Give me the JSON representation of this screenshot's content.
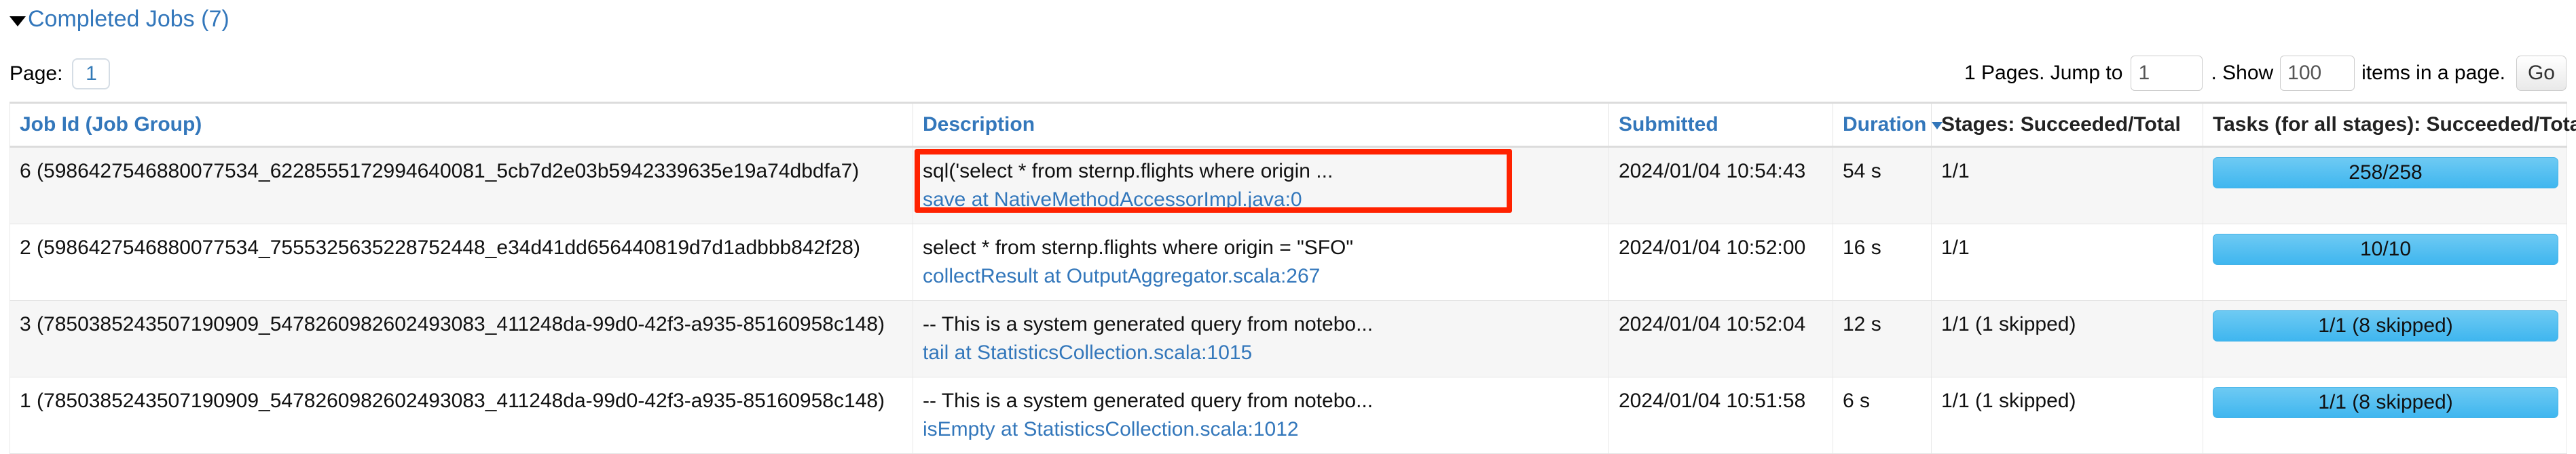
{
  "section": {
    "caret_icon": "caret-down-icon",
    "title": "Completed Jobs (7)"
  },
  "pagination": {
    "page_label": "Page:",
    "current_page": "1",
    "total_pages_text": "1 Pages. Jump to",
    "jump_value": "1",
    "show_text": ". Show",
    "show_value": "100",
    "items_text": "items in a page.",
    "go_label": "Go"
  },
  "table": {
    "headers": {
      "job_id": "Job Id (Job Group)",
      "description": "Description",
      "submitted": "Submitted",
      "duration": "Duration",
      "duration_sort_icon": "caret-down-icon",
      "stages": "Stages: Succeeded/Total",
      "tasks": "Tasks (for all stages): Succeeded/Total"
    },
    "rows": [
      {
        "job_id": "6 (5986427546880077534_6228555172994640081_5cb7d2e03b5942339635e19a74dbdfa7)",
        "desc_main": "sql('select * from sternp.flights where origin ...",
        "desc_link": "save at NativeMethodAccessorImpl.java:0",
        "submitted": "2024/01/04 10:54:43",
        "duration": "54 s",
        "stages": "1/1",
        "tasks": "258/258",
        "highlighted": true
      },
      {
        "job_id": "2 (5986427546880077534_7555325635228752448_e34d41dd656440819d7d1adbbb842f28)",
        "desc_main": "select * from sternp.flights where origin = \"SFO\"",
        "desc_link": "collectResult at OutputAggregator.scala:267",
        "submitted": "2024/01/04 10:52:00",
        "duration": "16 s",
        "stages": "1/1",
        "tasks": "10/10",
        "highlighted": false
      },
      {
        "job_id": "3 (7850385243507190909_5478260982602493083_411248da-99d0-42f3-a935-85160958c148)",
        "desc_main": "-- This is a system generated query from notebo...",
        "desc_link": "tail at StatisticsCollection.scala:1015",
        "submitted": "2024/01/04 10:52:04",
        "duration": "12 s",
        "stages": "1/1 (1 skipped)",
        "tasks": "1/1 (8 skipped)",
        "highlighted": false
      },
      {
        "job_id": "1 (7850385243507190909_5478260982602493083_411248da-99d0-42f3-a935-85160958c148)",
        "desc_main": "-- This is a system generated query from notebo...",
        "desc_link": "isEmpty at StatisticsCollection.scala:1012",
        "submitted": "2024/01/04 10:51:58",
        "duration": "6 s",
        "stages": "1/1 (1 skipped)",
        "tasks": "1/1 (8 skipped)",
        "highlighted": false
      }
    ]
  },
  "colors": {
    "link": "#3377bb",
    "task_bar": "#3fb6ef",
    "annotation": "#ff2200"
  }
}
